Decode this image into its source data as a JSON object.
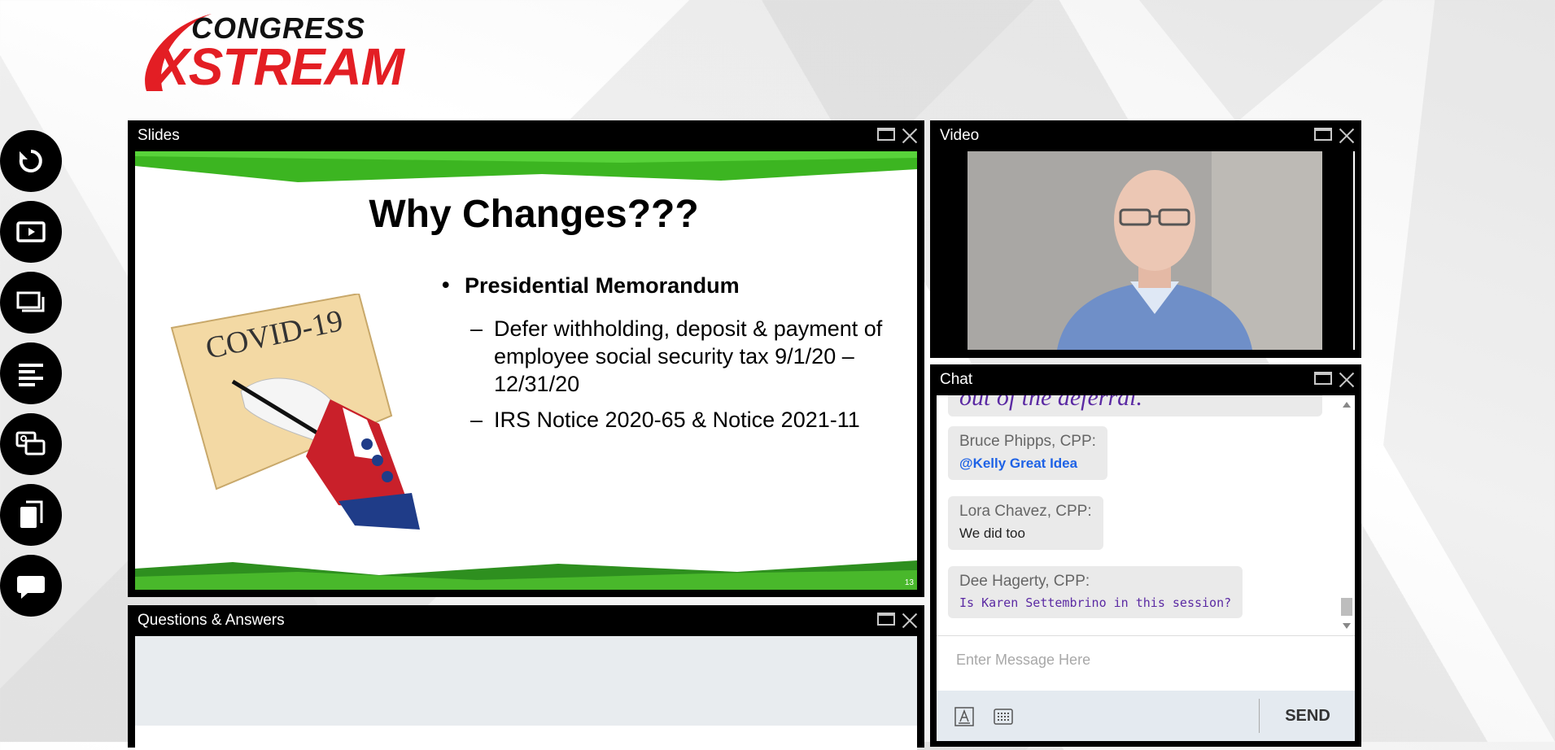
{
  "logo": {
    "line1": "CONGRESS",
    "line2": "XSTREAM"
  },
  "rail": [
    {
      "icon": "refresh-icon"
    },
    {
      "icon": "play-screen-icon"
    },
    {
      "icon": "slides-stack-icon"
    },
    {
      "icon": "text-align-icon"
    },
    {
      "icon": "chat-search-icon"
    },
    {
      "icon": "documents-icon"
    },
    {
      "icon": "speech-bubble-icon"
    }
  ],
  "slides_panel": {
    "title": "Slides",
    "slide": {
      "heading": "Why Changes???",
      "bullet": "Presidential Memorandum",
      "sub_bullets": [
        "Defer withholding, deposit & payment of employee social security tax 9/1/20 – 12/31/20",
        "IRS Notice 2020-65 & Notice 2021-11"
      ],
      "image_caption": "COVID-19",
      "page_number": "13"
    }
  },
  "qa_panel": {
    "title": "Questions & Answers"
  },
  "video_panel": {
    "title": "Video"
  },
  "chat_panel": {
    "title": "Chat",
    "partial_message": "out of the deferral.",
    "messages": [
      {
        "author": "Bruce Phipps, CPP:",
        "text": "@Kelly Great Idea"
      },
      {
        "author": "Lora Chavez, CPP:",
        "text": "We did too"
      },
      {
        "author": "Dee Hagerty, CPP:",
        "text": "Is Karen Settembrino in this session?"
      }
    ],
    "input_placeholder": "Enter Message Here",
    "send_label": "SEND"
  },
  "colors": {
    "brand_red": "#e31e24",
    "slide_green": "#3cb521",
    "mention_blue": "#1e62e6",
    "chat_purple": "#5b2aa3"
  }
}
